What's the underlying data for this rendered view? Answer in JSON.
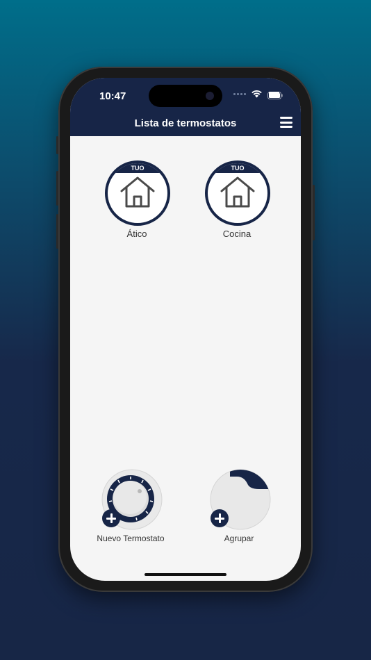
{
  "status_bar": {
    "time": "10:47"
  },
  "nav": {
    "title": "Lista de termostatos"
  },
  "thermostats": [
    {
      "badge": "TUO",
      "name": "Ático"
    },
    {
      "badge": "TUO",
      "name": "Cocina"
    }
  ],
  "actions": {
    "new_thermostat_label": "Nuevo Termostato",
    "group_label": "Agrupar"
  },
  "colors": {
    "primary": "#172547",
    "background": "#f5f5f5",
    "gradient_top": "#006e8a",
    "gradient_bottom": "#172646"
  },
  "icons": {
    "menu": "hamburger-menu-icon",
    "thermostat": "house-icon",
    "add": "plus-circle-icon",
    "wifi": "wifi-icon",
    "battery": "battery-icon"
  }
}
